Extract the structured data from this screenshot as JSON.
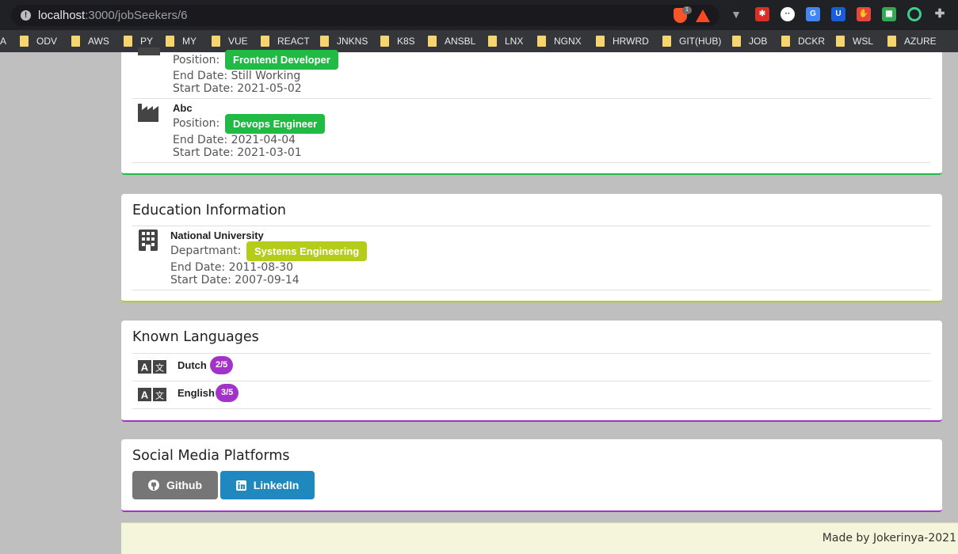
{
  "browser": {
    "url_host": "localhost",
    "url_path": ":3000/jobSeekers/6",
    "brave_badge": "1",
    "extensions": [
      "v-icon",
      "red-extension-icon",
      "dots-icon",
      "translate-icon",
      "bitwarden-icon",
      "adblock-icon",
      "sheet-icon",
      "circle-extension-icon",
      "puzzle-icon"
    ],
    "bookmarks": [
      "A",
      "ODV",
      "AWS",
      "PY",
      "MY",
      "VUE",
      "REACT",
      "JNKNS",
      "K8S",
      "ANSBL",
      "LNX",
      "NGNX",
      "HRWRD",
      "GIT(HUB)",
      "JOB",
      "DCKR",
      "WSL",
      "AZURE"
    ]
  },
  "experience": {
    "items": [
      {
        "company": "",
        "position_label": "Position:",
        "position": "Frontend Developer",
        "end_date": "End Date: Still Working",
        "start_date": "Start Date: 2021-05-02"
      },
      {
        "company": "Abc",
        "position_label": "Position:",
        "position": "Devops Engineer",
        "end_date": "End Date: 2021-04-04",
        "start_date": "Start Date: 2021-03-01"
      }
    ]
  },
  "education": {
    "title": "Education Information",
    "items": [
      {
        "school": "National University",
        "department_label": "Departmant:",
        "department": "Systems Engineering",
        "end_date": "End Date: 2011-08-30",
        "start_date": "Start Date: 2007-09-14"
      }
    ]
  },
  "languages": {
    "title": "Known Languages",
    "items": [
      {
        "name": "Dutch",
        "level": "2/5"
      },
      {
        "name": "English",
        "level": "3/5"
      }
    ]
  },
  "social": {
    "title": "Social Media Platforms",
    "github_label": "Github",
    "linkedin_label": "LinkedIn"
  },
  "footer": {
    "text": "Made by Jokerinya-2021"
  },
  "colors": {
    "green": "#21ba45",
    "olive": "#b5cc18",
    "violet": "#a333c8",
    "grey": "#767676",
    "linkedin": "#1f88be",
    "footer_bg": "#f5f5dc"
  }
}
